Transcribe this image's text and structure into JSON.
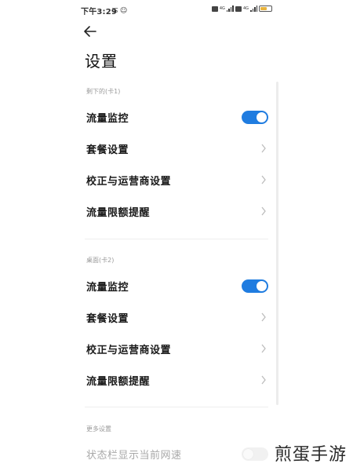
{
  "status_bar": {
    "time": "下午3:29",
    "notif_icons": "ऊ ☺",
    "net1": "4G",
    "net2": "4G",
    "battery_label": "battery",
    "battery_level": 0.62
  },
  "header": {
    "title": "设置"
  },
  "sim1": {
    "section_label": "剩下的(卡1)",
    "rows": [
      {
        "label": "流量监控",
        "control": "toggle",
        "on": true
      },
      {
        "label": "套餐设置",
        "control": "chevron"
      },
      {
        "label": "校正与运营商设置",
        "control": "chevron"
      },
      {
        "label": "流量限额提醒",
        "control": "chevron"
      }
    ]
  },
  "sim2": {
    "section_label": "桌面(卡2)",
    "rows": [
      {
        "label": "流量监控",
        "control": "toggle",
        "on": true
      },
      {
        "label": "套餐设置",
        "control": "chevron"
      },
      {
        "label": "校正与运营商设置",
        "control": "chevron"
      },
      {
        "label": "流量限额提醒",
        "control": "chevron"
      }
    ]
  },
  "more": {
    "section_label": "更多设置",
    "rows": [
      {
        "label": "状态栏显示当前网速",
        "control": "toggle",
        "on": false
      }
    ]
  },
  "watermark": "煎蛋手游",
  "colors": {
    "accent": "#1f7ce0",
    "section_header": "#9a9a9a",
    "chevron": "#bdbdbd"
  }
}
